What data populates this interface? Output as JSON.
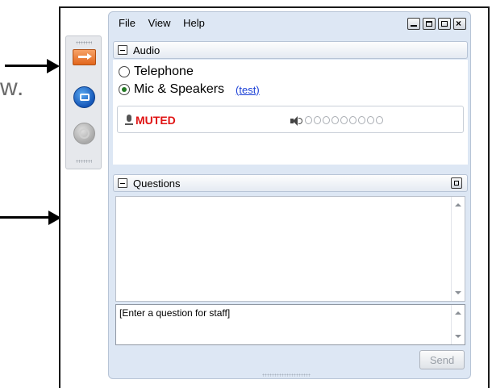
{
  "annotation": {
    "fragment_text": "w."
  },
  "menu": {
    "file": "File",
    "view": "View",
    "help": "Help"
  },
  "audio": {
    "title": "Audio",
    "telephone_label": "Telephone",
    "mic_label": "Mic & Speakers",
    "test_link": "(test)",
    "selected_option": "Mic & Speakers",
    "status_text": "MUTED",
    "status_color": "#e01414",
    "level_segments": 9
  },
  "questions": {
    "title": "Questions",
    "input_placeholder": "[Enter a question for staff]",
    "send_label": "Send"
  },
  "toolbar": {
    "buttons": [
      "orange-arrow-icon",
      "blue-screen-icon",
      "gray-disabled-icon"
    ]
  },
  "colors": {
    "panel_bg": "#dde7f4",
    "accent_orange": "#e2661d",
    "accent_blue": "#1556b8",
    "link": "#1a3fd6"
  }
}
